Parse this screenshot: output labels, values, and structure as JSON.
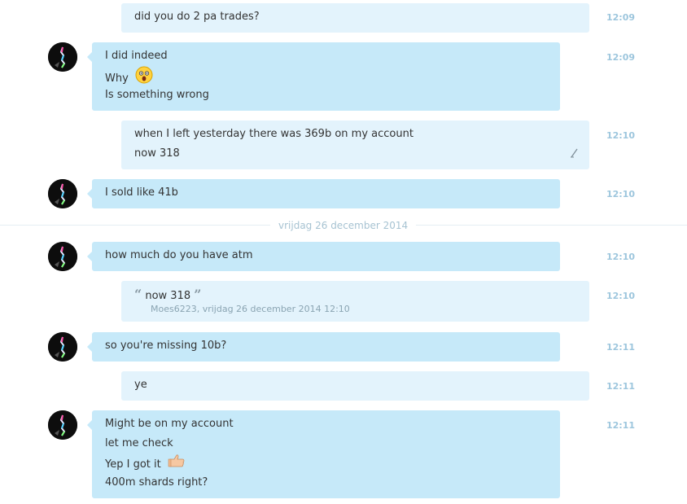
{
  "date_divider": "vrijdag 26 december 2014",
  "colors": {
    "outgoing_bubble": "#e3f3fc",
    "incoming_bubble": "#c6e9f9",
    "timestamp": "#9dc6dd"
  },
  "messages": [
    {
      "direction": "out",
      "lines": [
        "did you do 2 pa trades?"
      ],
      "time": "12:09"
    },
    {
      "direction": "in",
      "lines": [
        "I did indeed",
        "Why",
        "Is something wrong"
      ],
      "emoji": "surprised-face-emoji",
      "time": "12:09"
    },
    {
      "direction": "out",
      "lines": [
        "when I left yesterday there was 369b on my account",
        "now 318"
      ],
      "edited": true,
      "time": "12:10"
    },
    {
      "direction": "in",
      "lines": [
        "I sold like 41b"
      ],
      "time": "12:10"
    },
    {
      "direction": "in",
      "lines": [
        "how much do you have atm"
      ],
      "time": "12:10"
    },
    {
      "direction": "out",
      "quote": {
        "text": "now 318",
        "meta": "Moes6223, vrijdag 26 december 2014 12:10"
      },
      "time": "12:10"
    },
    {
      "direction": "in",
      "lines": [
        "so you're missing 10b?"
      ],
      "time": "12:11"
    },
    {
      "direction": "out",
      "lines": [
        "ye"
      ],
      "time": "12:11"
    },
    {
      "direction": "in",
      "lines": [
        "Might be on my account",
        "let me check",
        "Yep I got it",
        "400m shards right?"
      ],
      "emoji": "thumbs-up-emoji",
      "time": "12:11"
    }
  ]
}
